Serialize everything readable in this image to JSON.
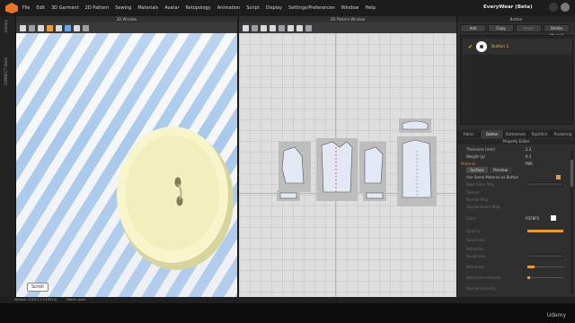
{
  "menubar": {
    "items": [
      "File",
      "Edit",
      "3D Garment",
      "2D Pattern",
      "Sewing",
      "Materials",
      "Avatar",
      "Retopology",
      "Animation",
      "Script",
      "Display",
      "Settings/Preferences",
      "Window",
      "Help"
    ],
    "brand": "EveryWear (Beta)"
  },
  "left_strip": {
    "tabs": [
      "Library",
      "CONNECT Store"
    ]
  },
  "window3d": {
    "title": "3D Window",
    "scroll_label": "Scroll"
  },
  "window2d": {
    "title": "2D Pattern Window"
  },
  "button_panel": {
    "title": "Button",
    "actions": [
      "Add",
      "Copy",
      "Paste",
      "Delete Unused"
    ],
    "disabled_action": "Paste",
    "selected_item": "Button 1"
  },
  "property_tabs": [
    "Fabric",
    "Button",
    "Buttonhole",
    "Topstitch",
    "Puckering"
  ],
  "active_tab": "Button",
  "property_editor": {
    "title": "Property Editor",
    "rows": [
      {
        "label": "Thickness (mm)",
        "value": "2.2"
      },
      {
        "label": "Weight (g)",
        "value": "0.1"
      },
      {
        "label": "Material",
        "value": "PBR"
      }
    ],
    "material_tabs": [
      "Surface",
      "Preview"
    ],
    "use_same_material": "Use Same Material as Button",
    "dim_rows": [
      "Base Color Map",
      "Texture",
      "Normal Map",
      "Displacement Map",
      "Color",
      "Opacity",
      "Glossiness",
      "Reflection",
      "Roughness",
      "Metalness",
      "Reflection Intensity",
      "Normal Intensity"
    ],
    "color_value": "FDF8F0"
  },
  "statusbar": {
    "version": "Version: 2019.2.2 (r15314)",
    "fabric": "Fabric: plain"
  },
  "watermark": "Udemy",
  "colors": {
    "accent": "#e99b3a",
    "selected_text": "#f2b43a",
    "button_cream": "#f7f5c9",
    "stripe_blue": "#a9c9ec"
  }
}
